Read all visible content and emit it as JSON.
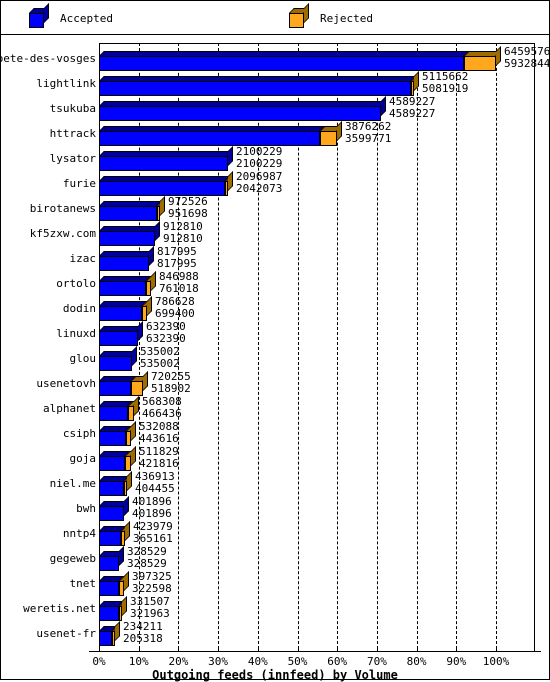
{
  "legend": {
    "items": [
      {
        "label": "Accepted",
        "color": "#0000ff",
        "dark": "#000099",
        "icon": "cube-icon"
      },
      {
        "label": "Rejected",
        "color": "#ffa81e",
        "dark": "#9e6b00",
        "icon": "cube-icon"
      }
    ]
  },
  "axis": {
    "x_title": "Outgoing feeds (innfeed) by Volume",
    "x_ticks": [
      "0%",
      "10%",
      "20%",
      "30%",
      "40%",
      "50%",
      "60%",
      "70%",
      "80%",
      "90%",
      "100%"
    ]
  },
  "chart_data": {
    "type": "bar",
    "orientation": "horizontal",
    "stacked": true,
    "title": "",
    "xlabel": "Outgoing feeds (innfeed) by Volume",
    "ylabel": "",
    "xlim": [
      0,
      6459576
    ],
    "xticks_percent": [
      0,
      10,
      20,
      30,
      40,
      50,
      60,
      70,
      80,
      90,
      100
    ],
    "grid": true,
    "legend_position": "top",
    "categories": [
      "bete-des-vosges",
      "lightlink",
      "tsukuba",
      "httrack",
      "lysator",
      "furie",
      "birotanews",
      "kf5zxw.com",
      "izac",
      "ortolo",
      "dodin",
      "linuxd",
      "glou",
      "usenetovh",
      "alphanet",
      "csiph",
      "goja",
      "niel.me",
      "bwh",
      "nntp4",
      "gegeweb",
      "tnet",
      "weretis.net",
      "usenet-fr"
    ],
    "series": [
      {
        "name": "Accepted",
        "color": "#0000ff",
        "values": [
          5932844,
          5081919,
          4589227,
          3599771,
          2100229,
          2042073,
          951698,
          912810,
          817995,
          761018,
          699400,
          632390,
          535002,
          518902,
          466436,
          443616,
          421816,
          404455,
          401896,
          365161,
          328529,
          322598,
          321963,
          205318
        ]
      },
      {
        "name": "Rejected",
        "color": "#ffa81e",
        "values": [
          526732,
          33743,
          0,
          276491,
          0,
          54914,
          20828,
          0,
          0,
          85970,
          87228,
          0,
          0,
          201353,
          101872,
          88472,
          90013,
          32458,
          0,
          58818,
          0,
          74727,
          9544,
          28893
        ]
      }
    ],
    "totals": [
      6459576,
      5115662,
      4589227,
      3876262,
      2100229,
      2096987,
      972526,
      912810,
      817995,
      846988,
      786628,
      632390,
      535002,
      720255,
      568308,
      532088,
      511829,
      436913,
      401896,
      423979,
      328529,
      397325,
      331507,
      234211
    ],
    "labels": [
      {
        "category": "bete-des-vosges",
        "total": "6459576",
        "accepted": "5932844"
      },
      {
        "category": "lightlink",
        "total": "5115662",
        "accepted": "5081919"
      },
      {
        "category": "tsukuba",
        "total": "4589227",
        "accepted": "4589227"
      },
      {
        "category": "httrack",
        "total": "3876262",
        "accepted": "3599771"
      },
      {
        "category": "lysator",
        "total": "2100229",
        "accepted": "2100229"
      },
      {
        "category": "furie",
        "total": "2096987",
        "accepted": "2042073"
      },
      {
        "category": "birotanews",
        "total": "972526",
        "accepted": "951698"
      },
      {
        "category": "kf5zxw.com",
        "total": "912810",
        "accepted": "912810"
      },
      {
        "category": "izac",
        "total": "817995",
        "accepted": "817995"
      },
      {
        "category": "ortolo",
        "total": "846988",
        "accepted": "761018"
      },
      {
        "category": "dodin",
        "total": "786628",
        "accepted": "699400"
      },
      {
        "category": "linuxd",
        "total": "632390",
        "accepted": "632390"
      },
      {
        "category": "glou",
        "total": "535002",
        "accepted": "535002"
      },
      {
        "category": "usenetovh",
        "total": "720255",
        "accepted": "518902"
      },
      {
        "category": "alphanet",
        "total": "568308",
        "accepted": "466436"
      },
      {
        "category": "csiph",
        "total": "532088",
        "accepted": "443616"
      },
      {
        "category": "goja",
        "total": "511829",
        "accepted": "421816"
      },
      {
        "category": "niel.me",
        "total": "436913",
        "accepted": "404455"
      },
      {
        "category": "bwh",
        "total": "401896",
        "accepted": "401896"
      },
      {
        "category": "nntp4",
        "total": "423979",
        "accepted": "365161"
      },
      {
        "category": "gegeweb",
        "total": "328529",
        "accepted": "328529"
      },
      {
        "category": "tnet",
        "total": "397325",
        "accepted": "322598"
      },
      {
        "category": "weretis.net",
        "total": "331507",
        "accepted": "321963"
      },
      {
        "category": "usenet-fr",
        "total": "234211",
        "accepted": "205318"
      }
    ]
  }
}
